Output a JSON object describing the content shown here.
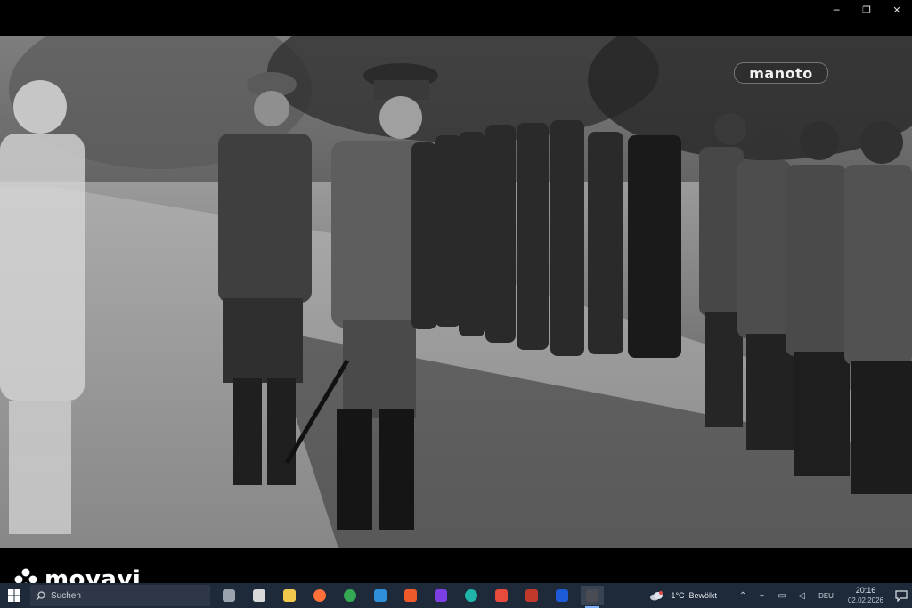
{
  "window": {
    "controls": [
      {
        "name": "minimize-button",
        "glyph": "─"
      },
      {
        "name": "restore-button",
        "glyph": "❐"
      },
      {
        "name": "close-button",
        "glyph": "✕"
      }
    ]
  },
  "video": {
    "channel_logo": "manoto"
  },
  "watermark": {
    "text": "movavi"
  },
  "taskbar": {
    "search_placeholder": "Suchen",
    "apps": [
      {
        "name": "task-view-icon",
        "color": "#9aa3ad"
      },
      {
        "name": "calendar-app-icon",
        "color": "#d9d9d9"
      },
      {
        "name": "file-explorer-icon",
        "color": "#f2c94c"
      },
      {
        "name": "firefox-icon",
        "color": "#ff7139"
      },
      {
        "name": "chrome-icon",
        "color": "#34a853"
      },
      {
        "name": "photos-app-icon",
        "color": "#2f8fd8"
      },
      {
        "name": "app-orange-icon",
        "color": "#f05a28"
      },
      {
        "name": "app-purple-icon",
        "color": "#7b3fe4"
      },
      {
        "name": "edge-icon",
        "color": "#1fb4a8"
      },
      {
        "name": "app-red-icon",
        "color": "#e84a3c"
      },
      {
        "name": "app-dark-red-icon",
        "color": "#c0392b"
      },
      {
        "name": "app-blue-icon",
        "color": "#1e5bd8"
      },
      {
        "name": "movavi-player-icon",
        "color": "#4b4b55",
        "active": true
      }
    ],
    "weather": {
      "temperature": "-1°C",
      "condition": "Bewölkt"
    },
    "language": "DEU",
    "time": "20:16",
    "date": "02.02.2026"
  }
}
